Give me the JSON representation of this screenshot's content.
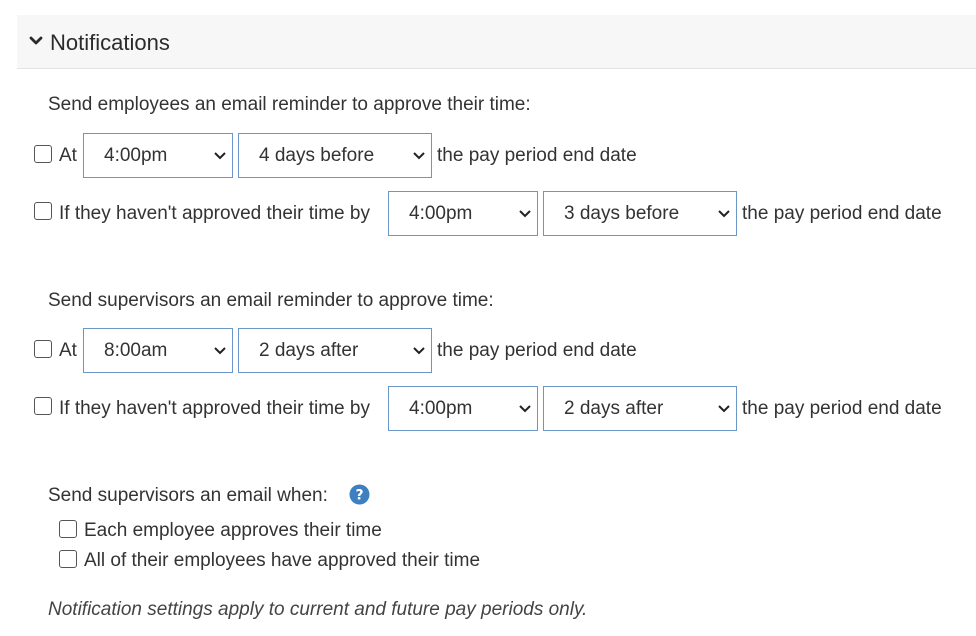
{
  "panel": {
    "title": "Notifications"
  },
  "employees": {
    "heading": "Send employees an email reminder to approve their time:",
    "row1": {
      "prefix": "At",
      "time": "4:00pm",
      "offset": "4 days before",
      "suffix": "the pay period end date"
    },
    "row2": {
      "prefix": "If they haven't approved their time by",
      "time": "4:00pm",
      "offset": "3 days before",
      "suffix": "the pay period end date"
    }
  },
  "supervisors": {
    "heading": "Send supervisors an email reminder to approve time:",
    "row1": {
      "prefix": "At",
      "time": "8:00am",
      "offset": "2 days after",
      "suffix": "the pay period end date"
    },
    "row2": {
      "prefix": "If they haven't approved their time by",
      "time": "4:00pm",
      "offset": "2 days after",
      "suffix": "the pay period end date"
    }
  },
  "supervisor_email": {
    "heading": "Send supervisors an email when:",
    "help_icon": "question-circle",
    "option1": "Each employee approves their time",
    "option2": "All of their employees have approved their time"
  },
  "footer_note": "Notification settings apply to current and future pay periods only.",
  "colors": {
    "select_border": "#6d96c8",
    "help_icon": "#3d7fc1",
    "header_bg": "#f7f7f7"
  }
}
